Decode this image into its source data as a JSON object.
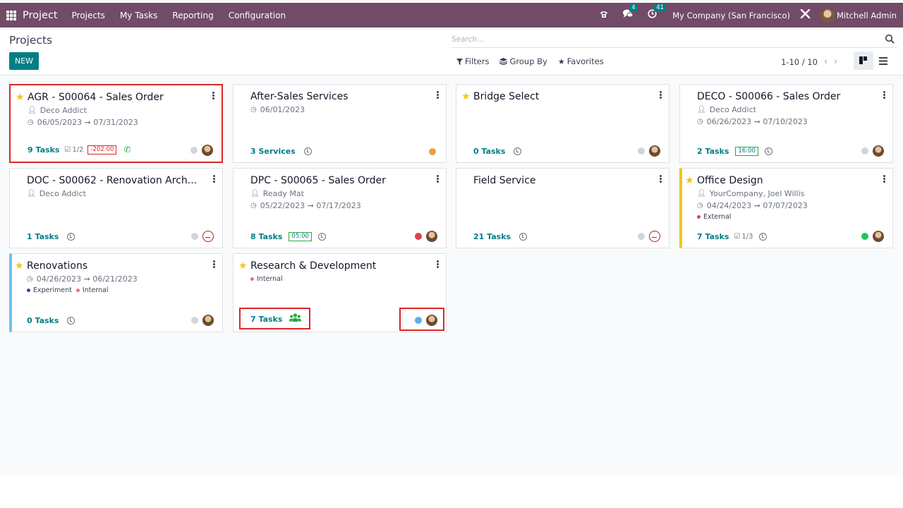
{
  "navbar": {
    "app_name": "Project",
    "menu": [
      "Projects",
      "My Tasks",
      "Reporting",
      "Configuration"
    ],
    "messages_badge": "4",
    "activities_badge": "41",
    "company": "My Company (San Francisco)",
    "user": "Mitchell Admin"
  },
  "control": {
    "title": "Projects",
    "new_label": "NEW",
    "search_placeholder": "Search...",
    "filters_label": "Filters",
    "group_by_label": "Group By",
    "favorites_label": "Favorites",
    "pager": "1-10 / 10"
  },
  "cards": [
    {
      "title": "AGR - S00064 - Sales Order",
      "starred": true,
      "customer": "Deco Addict",
      "dates": "06/05/2023 ➞ 07/31/2023",
      "count_label": "9 Tasks",
      "milestones": "1/2",
      "time_chip": "-202:00",
      "status_color": "#d1d5db"
    },
    {
      "title": "After-Sales Services",
      "starred": false,
      "dates": "06/01/2023",
      "count_label": "3 Services",
      "status_color": "#e9a23b"
    },
    {
      "title": "Bridge Select",
      "starred": true,
      "count_label": "0 Tasks",
      "status_color": "#d1d5db"
    },
    {
      "title": "DECO - S00066 - Sales Order",
      "starred": false,
      "customer": "Deco Addict",
      "dates": "06/26/2023 ➞ 07/10/2023",
      "count_label": "2 Tasks",
      "time_chip": "16:00",
      "status_color": "#d1d5db"
    },
    {
      "title": "DOC - S00062 - Renovation Arch...",
      "starred": false,
      "customer": "Deco Addict",
      "count_label": "1 Tasks",
      "status_color": "#d1d5db"
    },
    {
      "title": "DPC - S00065 - Sales Order",
      "starred": false,
      "customer": "Ready Mat",
      "dates": "05/22/2023 ➞ 07/17/2023",
      "count_label": "8 Tasks",
      "time_chip": "05:00",
      "status_color": "#e0424b"
    },
    {
      "title": "Field Service",
      "starred": false,
      "count_label": "21 Tasks",
      "status_color": "#d1d5db"
    },
    {
      "title": "Office Design",
      "starred": true,
      "customer": "YourCompany, Joel Willis",
      "dates": "04/24/2023 ➞ 07/07/2023",
      "tags": [
        {
          "label": "External",
          "color": "#e0424b"
        }
      ],
      "count_label": "7 Tasks",
      "milestones": "1/3",
      "status_color": "#21c55d"
    },
    {
      "title": "Renovations",
      "starred": true,
      "dates": "04/26/2023 ➞ 06/21/2023",
      "tags": [
        {
          "label": "Experiment",
          "color": "#4c3d8a"
        },
        {
          "label": "Internal",
          "color": "#f06b7a"
        }
      ],
      "count_label": "0 Tasks",
      "status_color": "#d1d5db"
    },
    {
      "title": "Research & Development",
      "starred": true,
      "tags": [
        {
          "label": "Internal",
          "color": "#f06b7a"
        }
      ],
      "count_label": "7 Tasks",
      "status_color": "#5aaee8"
    }
  ]
}
